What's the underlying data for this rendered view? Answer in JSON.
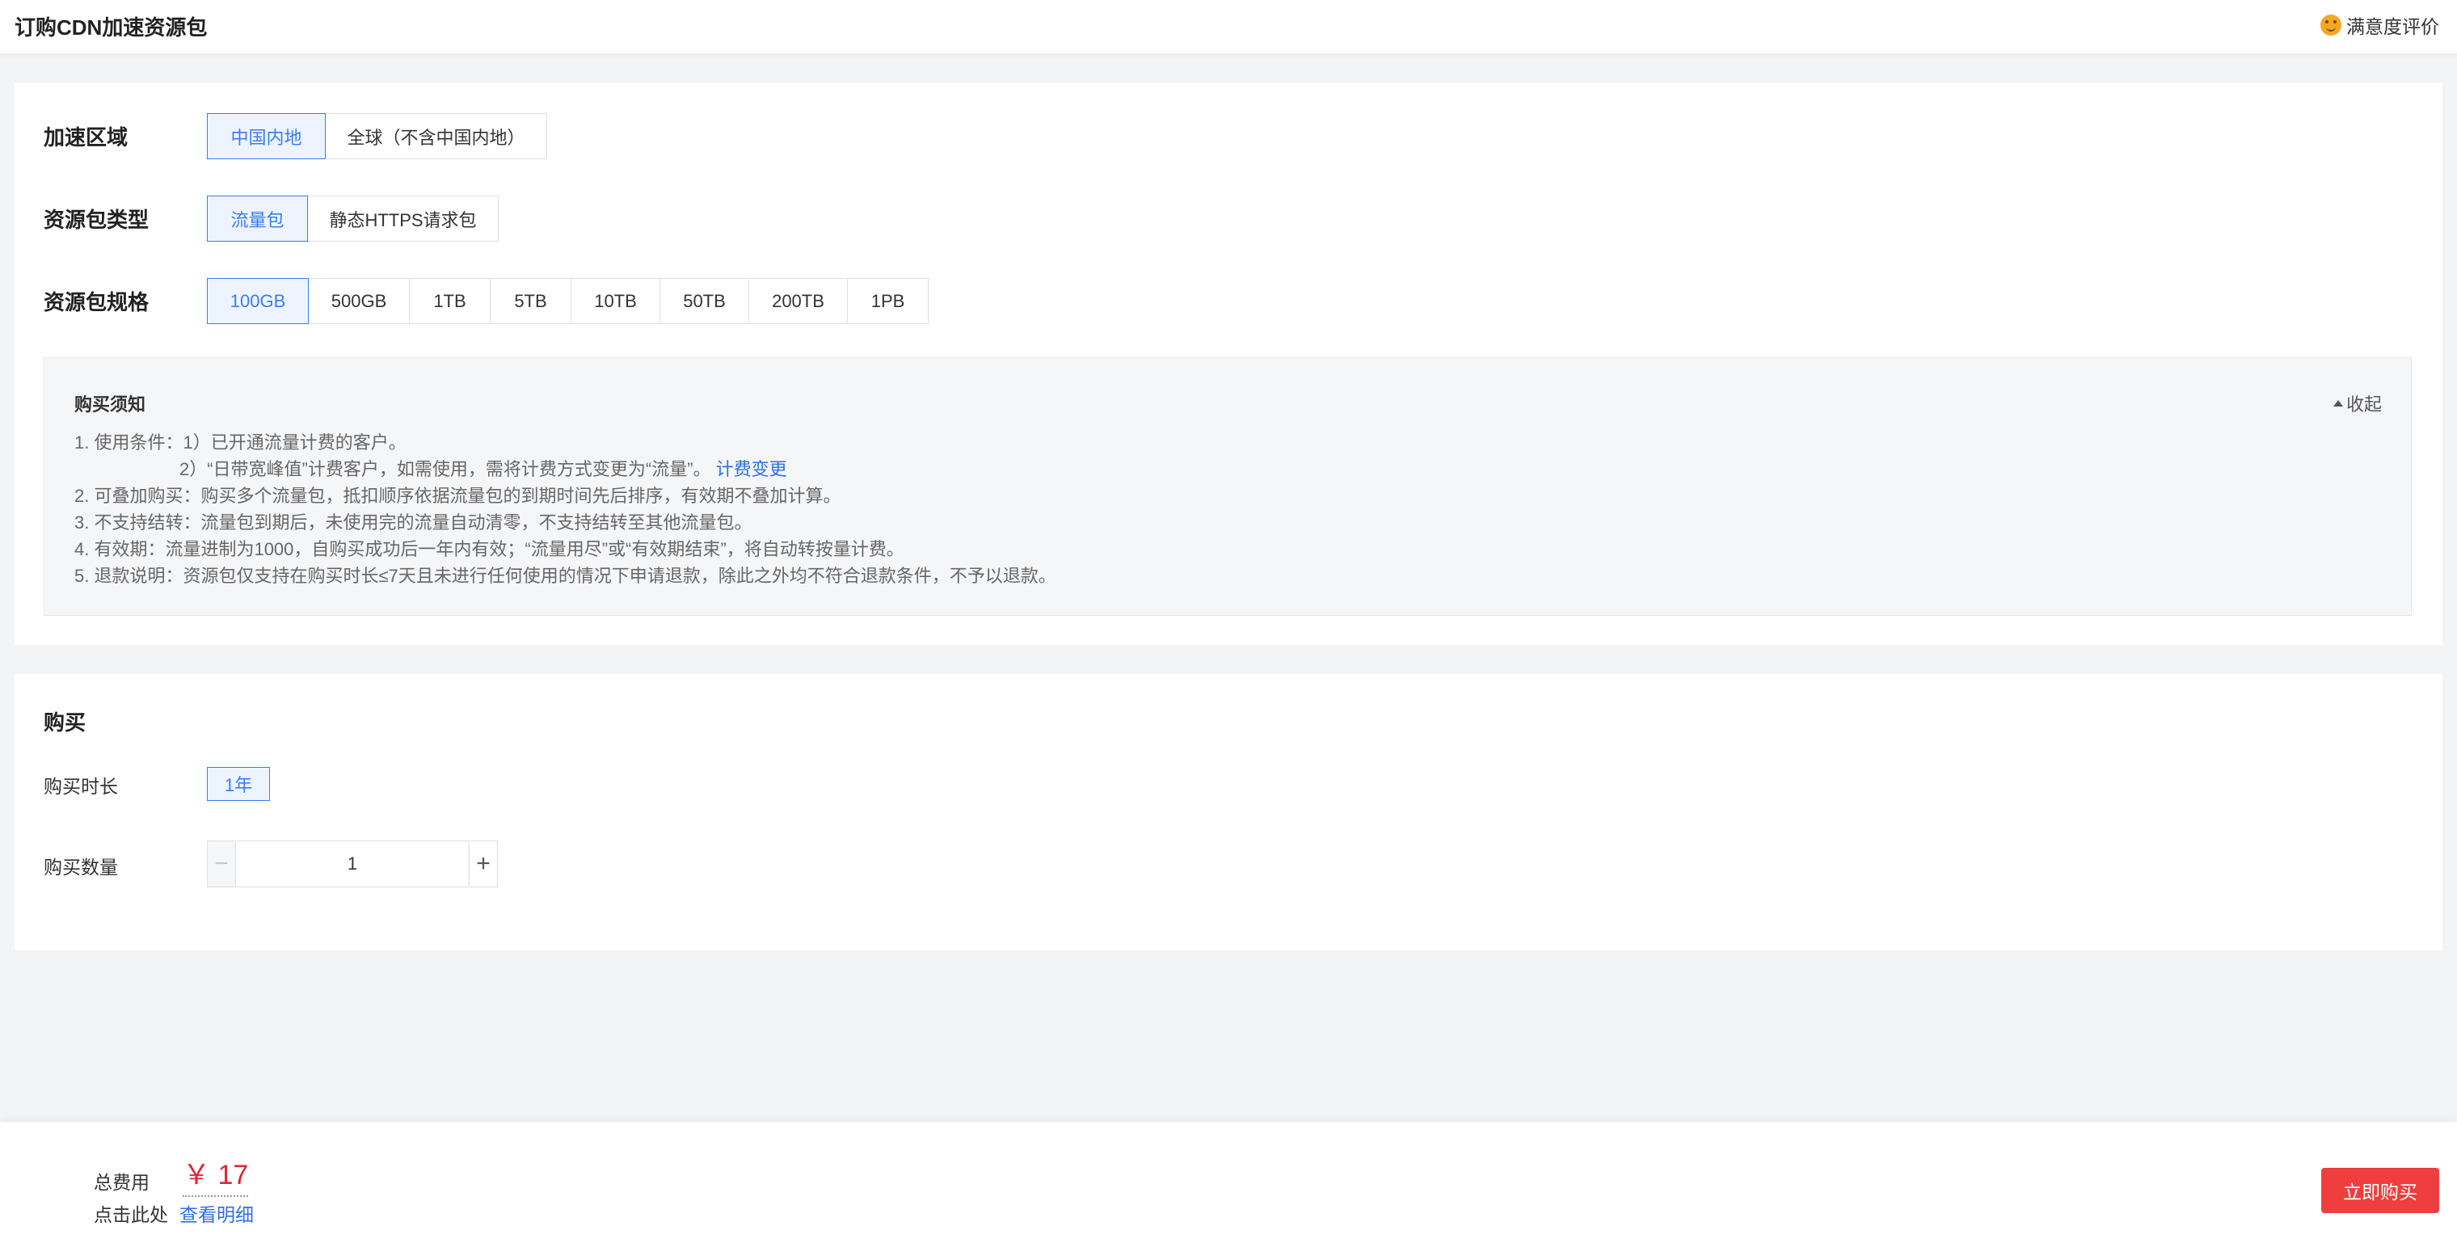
{
  "header": {
    "title": "订购CDN加速资源包",
    "feedback_label": "满意度评价"
  },
  "config": {
    "region": {
      "label": "加速区域",
      "options": [
        "中国内地",
        "全球（不含中国内地）"
      ],
      "selected": "中国内地"
    },
    "package_type": {
      "label": "资源包类型",
      "options": [
        "流量包",
        "静态HTTPS请求包"
      ],
      "selected": "流量包"
    },
    "spec": {
      "label": "资源包规格",
      "options": [
        "100GB",
        "500GB",
        "1TB",
        "5TB",
        "10TB",
        "50TB",
        "200TB",
        "1PB"
      ],
      "selected": "100GB"
    }
  },
  "notice": {
    "title": "购买须知",
    "collapse_label": "收起",
    "line1": "1. 使用条件：1）已开通流量计费的客户。",
    "line1b": "2）“日带宽峰值”计费客户，如需使用，需将计费方式变更为“流量”。",
    "line1b_link": "计费变更",
    "line2": "2. 可叠加购买：购买多个流量包，抵扣顺序依据流量包的到期时间先后排序，有效期不叠加计算。",
    "line3": "3. 不支持结转：流量包到期后，未使用完的流量自动清零，不支持结转至其他流量包。",
    "line4": "4. 有效期：流量进制为1000，自购买成功后一年内有效；“流量用尽”或“有效期结束”，将自动转按量计费。",
    "line5": "5. 退款说明：资源包仅支持在购买时长≤7天且未进行任何使用的情况下申请退款，除此之外均不符合退款条件，不予以退款。"
  },
  "purchase": {
    "title": "购买",
    "duration_label": "购买时长",
    "duration_value": "1年",
    "quantity_label": "购买数量",
    "quantity_value": "1"
  },
  "footer": {
    "total_label": "总费用",
    "price": "￥ 17",
    "click_label": "点击此处",
    "detail_link": "查看明细",
    "buy_button": "立即购买"
  },
  "colors": {
    "accent": "#3a7bf2",
    "price": "#e02433",
    "buy_button": "#f03d3d"
  }
}
